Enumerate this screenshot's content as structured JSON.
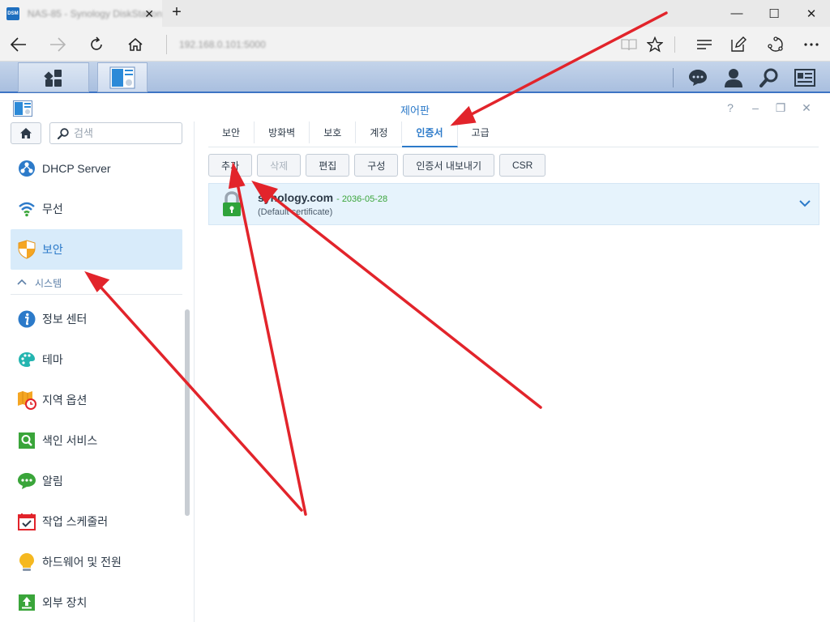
{
  "browser": {
    "tab_title": "NAS-85 - Synology DiskStation",
    "favicon_text": "DSM",
    "address": "192.168.0.101:5000",
    "new_tab_label": "+",
    "window_controls": [
      "minimize-icon",
      "maximize-icon",
      "close-icon"
    ],
    "nav_icons": [
      "back-icon",
      "forward-icon",
      "refresh-icon",
      "home-icon"
    ],
    "toolbar_icons": [
      "reading-view-icon",
      "favorite-star-icon",
      "hub-icon",
      "web-note-icon",
      "share-icon",
      "more-icon"
    ]
  },
  "dsm_taskbar": {
    "left_buttons": [
      "main-menu-icon",
      "control-panel-task-icon"
    ],
    "right_icons": [
      "messages-icon",
      "user-icon",
      "search-icon",
      "widgets-icon"
    ]
  },
  "window": {
    "title": "제어판",
    "controls": [
      "?",
      "–",
      "❐",
      "✕"
    ]
  },
  "sidebar": {
    "search_placeholder": "검색",
    "items_top": [
      {
        "label": "DHCP Server",
        "icon": "dhcp-server-icon"
      },
      {
        "label": "무선",
        "icon": "wireless-icon"
      },
      {
        "label": "보안",
        "icon": "security-shield-icon",
        "active": true
      }
    ],
    "section_label": "시스템",
    "items_system": [
      {
        "label": "정보 센터",
        "icon": "info-center-icon"
      },
      {
        "label": "테마",
        "icon": "theme-palette-icon"
      },
      {
        "label": "지역 옵션",
        "icon": "regional-options-icon"
      },
      {
        "label": "색인 서비스",
        "icon": "indexing-service-icon"
      },
      {
        "label": "알림",
        "icon": "notification-icon"
      },
      {
        "label": "작업 스케줄러",
        "icon": "task-scheduler-icon"
      },
      {
        "label": "하드웨어 및 전원",
        "icon": "hardware-power-icon"
      },
      {
        "label": "외부 장치",
        "icon": "external-devices-icon"
      }
    ]
  },
  "tabs": [
    {
      "label": "보안"
    },
    {
      "label": "방화벽"
    },
    {
      "label": "보호"
    },
    {
      "label": "계정"
    },
    {
      "label": "인증서",
      "active": true
    },
    {
      "label": "고급"
    }
  ],
  "toolbar": {
    "add": "추가",
    "delete": "삭제",
    "edit": "편집",
    "configure": "구성",
    "export": "인증서 내보내기",
    "csr": "CSR"
  },
  "certificate": {
    "name": "synology.com",
    "date": "- 2036-05-28",
    "subtitle": "(Default certificate)"
  },
  "colors": {
    "accent": "#2c7ac9",
    "active_bg": "#d8ebfa",
    "arrow": "#e2242b",
    "valid_date": "#3aa53a"
  }
}
